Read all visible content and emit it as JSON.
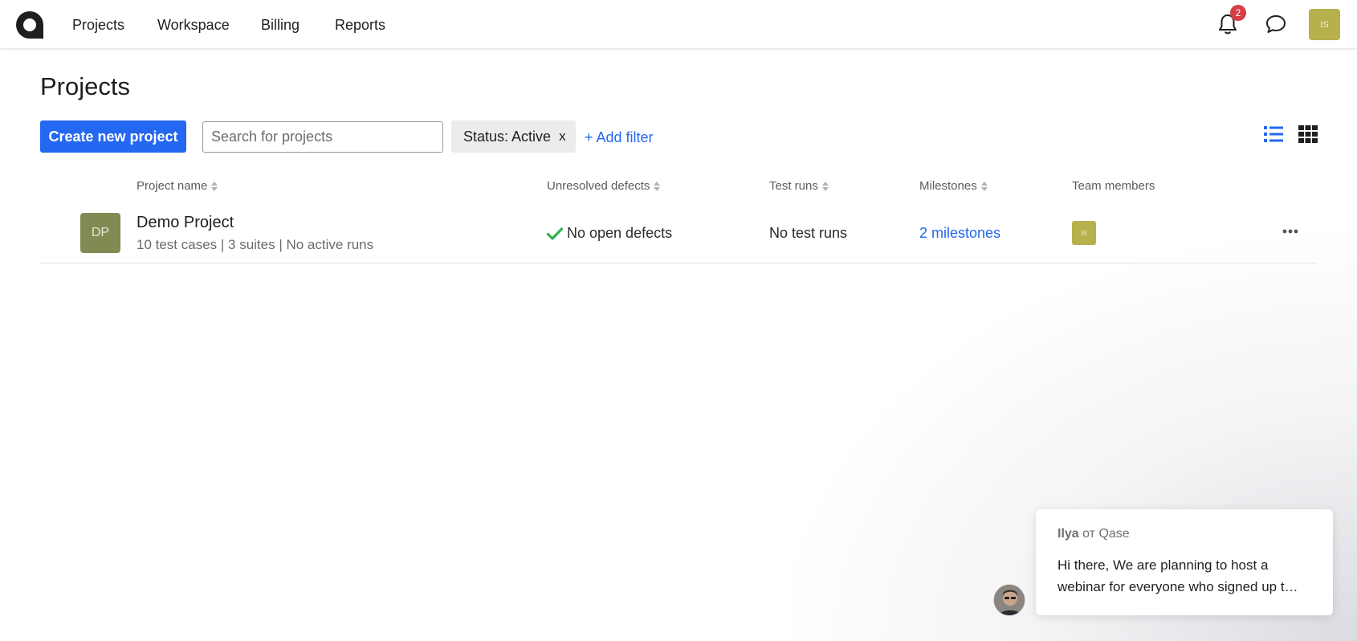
{
  "nav": {
    "items": [
      {
        "label": "Projects"
      },
      {
        "label": "Workspace"
      },
      {
        "label": "Billing"
      },
      {
        "label": "Reports"
      }
    ],
    "notifications_count": "2",
    "user_initials": "IS"
  },
  "page": {
    "title": "Projects",
    "create_button": "Create new project",
    "search_placeholder": "Search for projects",
    "filter_chip": "Status: Active",
    "filter_chip_close": "x",
    "add_filter": "+ Add filter"
  },
  "table": {
    "headers": {
      "name": "Project name",
      "defects": "Unresolved defects",
      "runs": "Test runs",
      "milestones": "Milestones",
      "members": "Team members"
    },
    "rows": [
      {
        "avatar": "DP",
        "name": "Demo Project",
        "meta": "10 test cases | 3 suites | No active runs",
        "defects": "No open defects",
        "runs": "No test runs",
        "milestones": "2 milestones",
        "member_initials": "IS"
      }
    ]
  },
  "chat_widget": {
    "sender": "Ilya",
    "sender_suffix": " от Qase",
    "message": "Hi there, We are planning to host a webinar for everyone who signed up t…"
  },
  "colors": {
    "accent": "#2467f0",
    "badge": "#d63d45",
    "user_avatar": "#b6b04d",
    "project_avatar": "#7f8b52",
    "success": "#2fb34a"
  },
  "icons": [
    "logo-icon",
    "bell-icon",
    "chat-bubble-icon",
    "list-view-icon",
    "grid-view-icon",
    "sort-icon",
    "check-icon",
    "more-icon"
  ]
}
